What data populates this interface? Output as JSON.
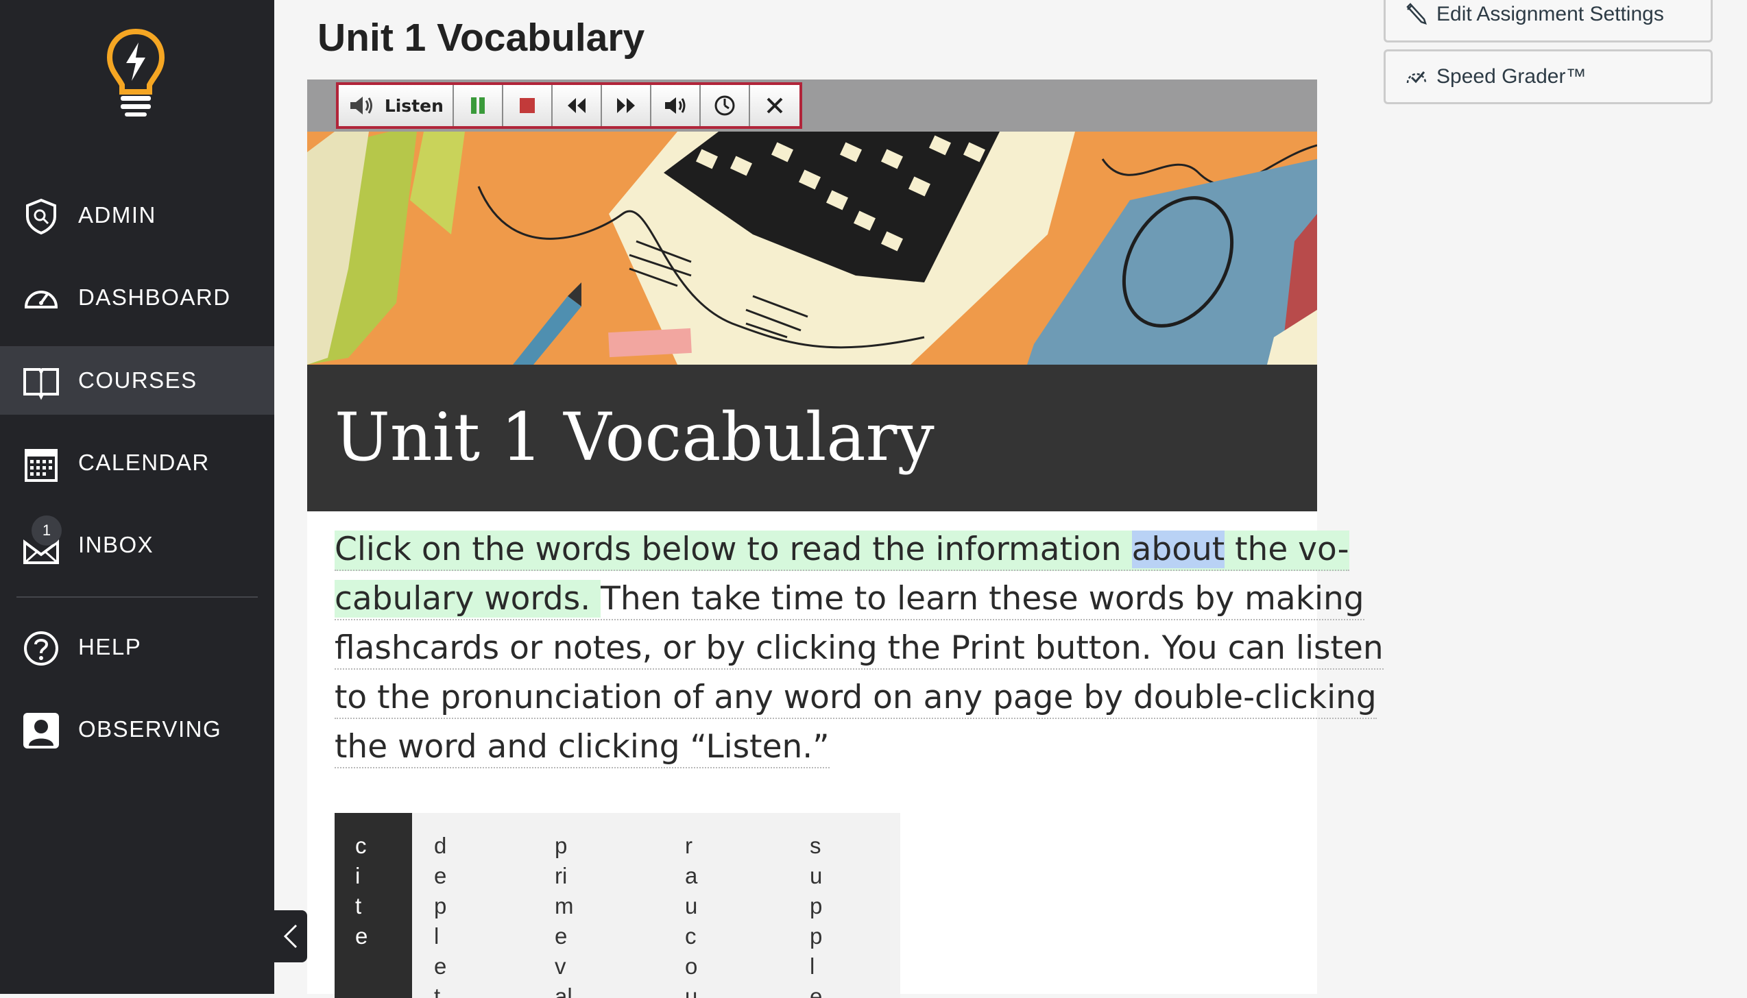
{
  "sidebar": {
    "items": [
      {
        "label": "ADMIN",
        "icon": "shield-icon"
      },
      {
        "label": "DASHBOARD",
        "icon": "speedometer-icon"
      },
      {
        "label": "COURSES",
        "icon": "book-icon",
        "active": true
      },
      {
        "label": "CALENDAR",
        "icon": "calendar-icon"
      },
      {
        "label": "INBOX",
        "icon": "inbox-icon",
        "badge": "1"
      },
      {
        "label": "HELP",
        "icon": "help-icon"
      },
      {
        "label": "OBSERVING",
        "icon": "person-icon"
      }
    ]
  },
  "page": {
    "title": "Unit 1 Vocabulary"
  },
  "tts": {
    "listen_label": "Listen"
  },
  "content": {
    "heading": "Unit 1 Vocabulary",
    "intro_lines": [
      [
        "Click on the words below to read the information ",
        "about",
        " the vo-"
      ],
      [
        "cabulary words. ",
        "Then take time to learn these words by making"
      ],
      [
        "flashcards or notes, or by clicking the Print button. You can listen"
      ],
      [
        "to the pronunciation of any word on any page by double-clicking"
      ],
      [
        "the word and clicking “Listen.”"
      ]
    ],
    "words": [
      {
        "letters": [
          "c",
          "i",
          "t",
          "e"
        ]
      },
      {
        "letters": [
          "d",
          "e",
          "p",
          "l",
          "e",
          "t"
        ]
      },
      {
        "letters": [
          "p",
          "ri",
          "m",
          "e",
          "v",
          "al"
        ]
      },
      {
        "letters": [
          "r",
          "a",
          "u",
          "c",
          "o",
          "u"
        ]
      },
      {
        "letters": [
          "s",
          "u",
          "p",
          "p",
          "l",
          "e"
        ]
      }
    ]
  },
  "right_panel": {
    "edit_label": "Edit Assignment Settings",
    "grader_label": "Speed Grader™"
  },
  "colors": {
    "sidebar": "#232428",
    "accent": "#f5a623",
    "tts_border": "#b1253a",
    "highlight": "#d6f8dc",
    "word_highlight": "#b9d2f5"
  }
}
